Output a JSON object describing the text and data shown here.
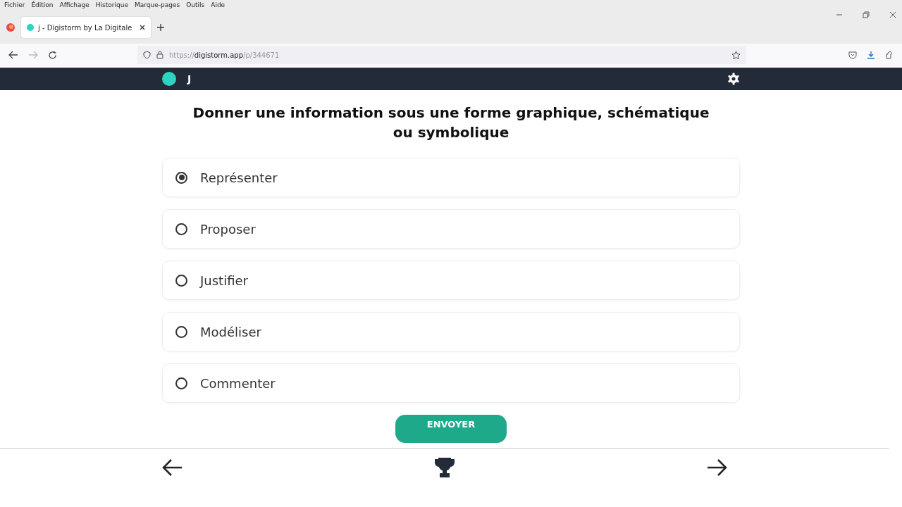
{
  "menu_bar": [
    "Fichier",
    "Édition",
    "Affichage",
    "Historique",
    "Marque-pages",
    "Outils",
    "Aide"
  ],
  "tab": {
    "title": "j - Digistorm by La Digitale",
    "selected": true
  },
  "address_bar": {
    "prefix": "https://",
    "domain": "digistorm.app",
    "path": "/p/344671"
  },
  "header": {
    "user": "J"
  },
  "question": "Donner une information sous une forme graphique, schématique ou symbolique",
  "options": [
    {
      "label": "Représenter",
      "selected": true
    },
    {
      "label": "Proposer",
      "selected": false
    },
    {
      "label": "Justifier",
      "selected": false
    },
    {
      "label": "Modéliser",
      "selected": false
    },
    {
      "label": "Commenter",
      "selected": false
    }
  ],
  "submit": "ENVOYER"
}
